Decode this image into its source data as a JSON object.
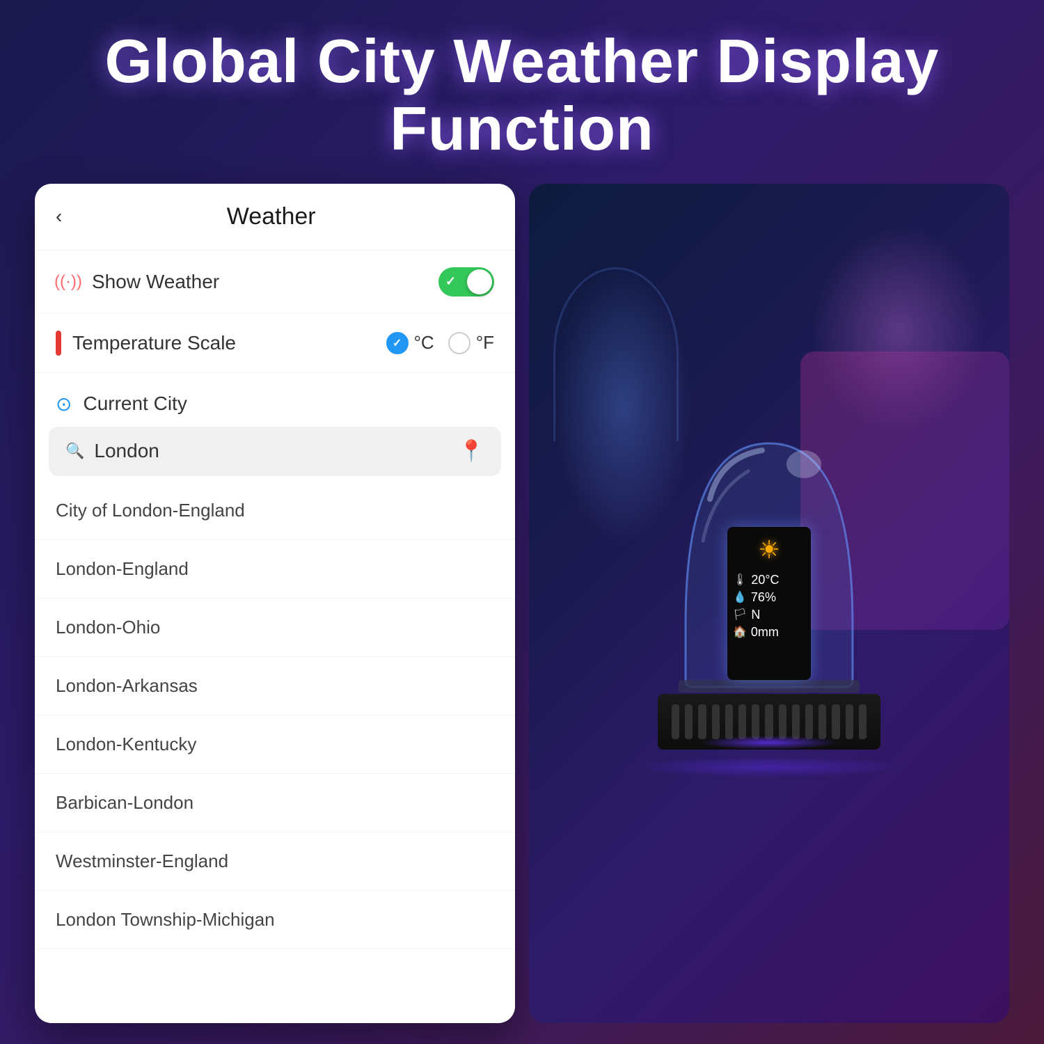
{
  "headline": {
    "line1": "Global City Weather Display",
    "line2": "Function"
  },
  "phone": {
    "back_label": "‹",
    "title": "Weather",
    "show_weather_label": "Show Weather",
    "show_weather_enabled": true,
    "temperature_scale_label": "Temperature Scale",
    "celsius_label": "°C",
    "fahrenheit_label": "°F",
    "celsius_selected": true,
    "current_city_label": "Current City",
    "search_placeholder": "London",
    "city_results": [
      "City of London-England",
      "London-England",
      "London-Ohio",
      "London-Arkansas",
      "London-Kentucky",
      "Barbican-London",
      "Westminster-England",
      "London Township-Michigan"
    ]
  },
  "device_display": {
    "sun_icon": "☀",
    "temperature": "20°C",
    "humidity": "76%",
    "wind_dir": "N",
    "rainfall": "0mm",
    "temp_icon": "🌡",
    "humidity_icon": "💧",
    "wind_icon": "🏳",
    "rain_icon": "🏠"
  },
  "icons": {
    "wifi": "((·))",
    "thermometer": "▌",
    "location": "📍",
    "search": "🔍",
    "gps_pin": "📍",
    "back": "‹",
    "checkmark": "✓"
  }
}
